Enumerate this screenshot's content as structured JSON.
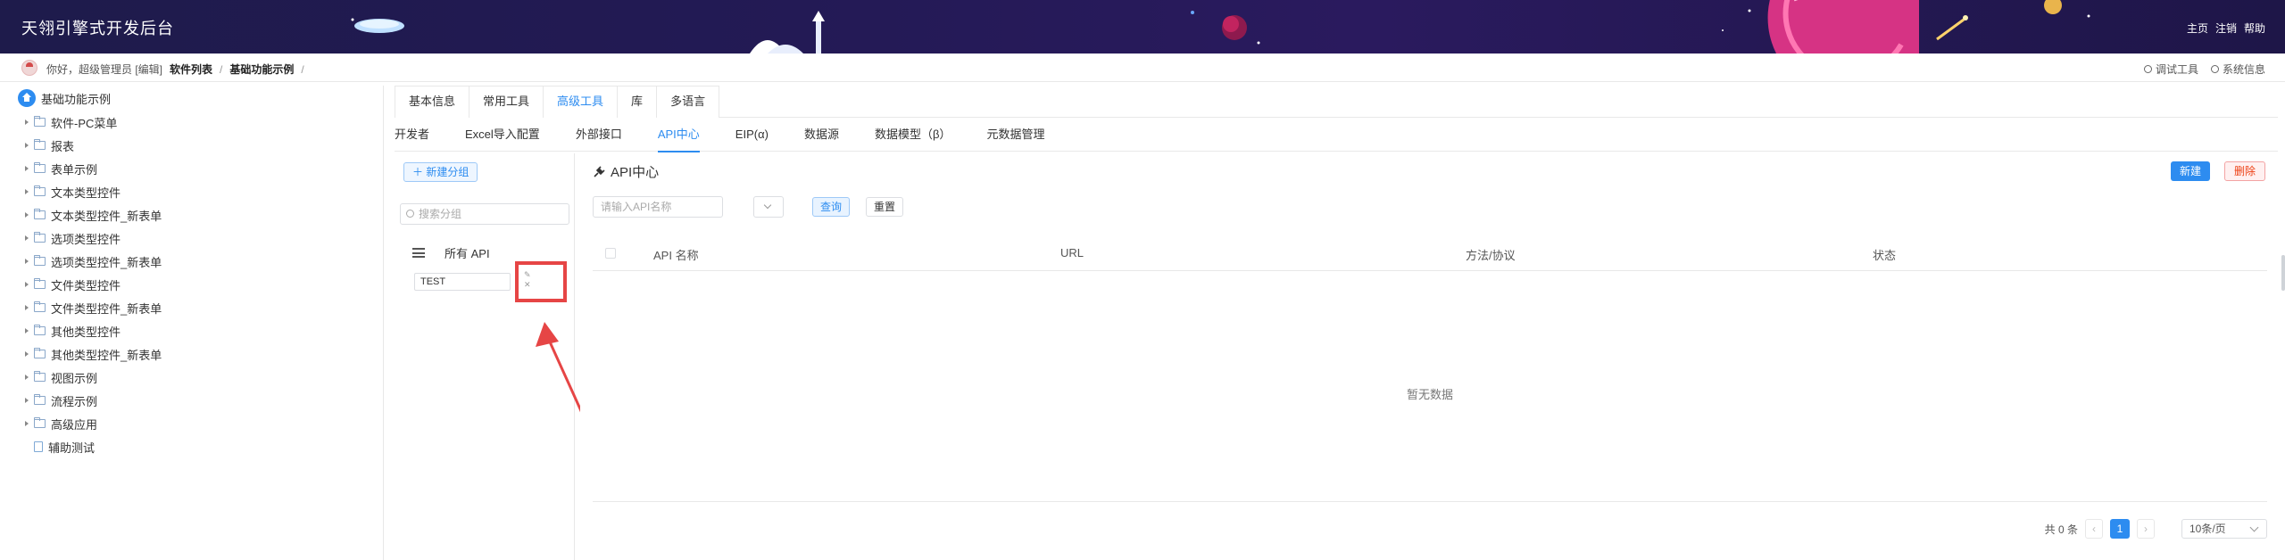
{
  "header": {
    "title": "天翎引擎式开发后台",
    "nav": [
      "主页",
      "注销",
      "帮助"
    ]
  },
  "topbar": {
    "greeting": "你好，超级管理员 [编辑]",
    "crumbs": [
      "软件列表",
      "/",
      "基础功能示例",
      "/"
    ],
    "tools": [
      "调试工具",
      "系统信息"
    ]
  },
  "tree": {
    "root": "基础功能示例",
    "items": [
      {
        "label": "软件-PC菜单",
        "type": "folder"
      },
      {
        "label": "报表",
        "type": "folder"
      },
      {
        "label": "表单示例",
        "type": "folder"
      },
      {
        "label": "文本类型控件",
        "type": "folder"
      },
      {
        "label": "文本类型控件_新表单",
        "type": "folder"
      },
      {
        "label": "选项类型控件",
        "type": "folder"
      },
      {
        "label": "选项类型控件_新表单",
        "type": "folder"
      },
      {
        "label": "文件类型控件",
        "type": "folder"
      },
      {
        "label": "文件类型控件_新表单",
        "type": "folder"
      },
      {
        "label": "其他类型控件",
        "type": "folder"
      },
      {
        "label": "其他类型控件_新表单",
        "type": "folder"
      },
      {
        "label": "视图示例",
        "type": "folder"
      },
      {
        "label": "流程示例",
        "type": "folder"
      },
      {
        "label": "高级应用",
        "type": "folder"
      },
      {
        "label": "辅助测试",
        "type": "file"
      }
    ]
  },
  "tabs_primary": [
    "基本信息",
    "常用工具",
    "高级工具",
    "库",
    "多语言"
  ],
  "tabs_primary_active": "高级工具",
  "tabs_secondary": [
    "开发者",
    "Excel导入配置",
    "外部接口",
    "API中心",
    "EIP(α)",
    "数据源",
    "数据模型（β）",
    "元数据管理"
  ],
  "tabs_secondary_active": "API中心",
  "groups": {
    "new_button": "＋ 新建分组",
    "search_placeholder": "搜索分组",
    "all_label": "所有 API",
    "items": [
      "TEST"
    ],
    "edit_glyph": "✎ ✕"
  },
  "main": {
    "heading": "API中心",
    "create_button": "新建",
    "delete_button": "删除",
    "search_placeholder": "请输入API名称",
    "query_button": "查询",
    "reset_button": "重置",
    "columns": [
      "API 名称",
      "URL",
      "方法/协议",
      "状态"
    ],
    "empty_text": "暂无数据",
    "pager": {
      "total": "共 0 条",
      "current": "1",
      "page_size": "10条/页"
    }
  },
  "colors": {
    "accent": "#2d8cf0",
    "header_bg": "#1e1b4b",
    "highlight": "#e64545"
  }
}
